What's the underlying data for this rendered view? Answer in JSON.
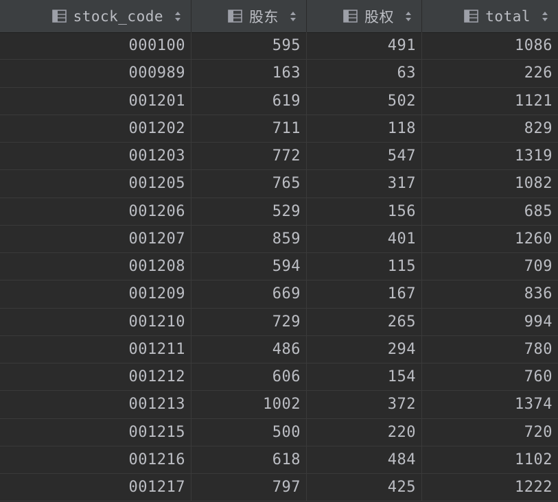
{
  "columns": [
    {
      "label": "stock_code",
      "icon": "column-icon",
      "sort_icon": "sort-arrows-icon"
    },
    {
      "label": "股东",
      "icon": "column-icon",
      "sort_icon": "sort-arrows-icon"
    },
    {
      "label": "股权",
      "icon": "column-icon",
      "sort_icon": "sort-arrows-icon"
    },
    {
      "label": "total",
      "icon": "column-icon",
      "sort_icon": "sort-arrows-icon"
    }
  ],
  "rows": [
    [
      "000100",
      "595",
      "491",
      "1086"
    ],
    [
      "000989",
      "163",
      "63",
      "226"
    ],
    [
      "001201",
      "619",
      "502",
      "1121"
    ],
    [
      "001202",
      "711",
      "118",
      "829"
    ],
    [
      "001203",
      "772",
      "547",
      "1319"
    ],
    [
      "001205",
      "765",
      "317",
      "1082"
    ],
    [
      "001206",
      "529",
      "156",
      "685"
    ],
    [
      "001207",
      "859",
      "401",
      "1260"
    ],
    [
      "001208",
      "594",
      "115",
      "709"
    ],
    [
      "001209",
      "669",
      "167",
      "836"
    ],
    [
      "001210",
      "729",
      "265",
      "994"
    ],
    [
      "001211",
      "486",
      "294",
      "780"
    ],
    [
      "001212",
      "606",
      "154",
      "760"
    ],
    [
      "001213",
      "1002",
      "372",
      "1374"
    ],
    [
      "001215",
      "500",
      "220",
      "720"
    ],
    [
      "001216",
      "618",
      "484",
      "1102"
    ],
    [
      "001217",
      "797",
      "425",
      "1222"
    ]
  ],
  "colors": {
    "background": "#2b2b2b",
    "header_background": "#3c3f41",
    "text": "#bcbec4",
    "grid_line": "#3a3a3a"
  }
}
